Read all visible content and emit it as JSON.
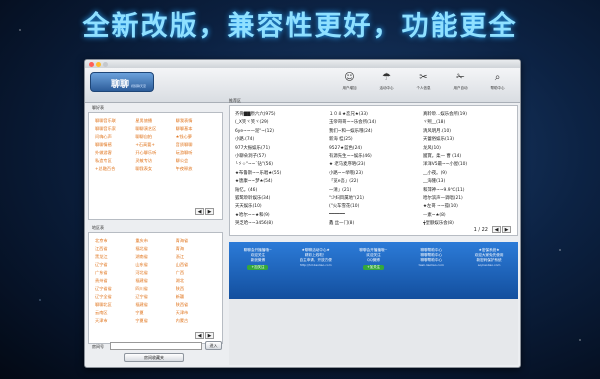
{
  "headline": "全新改版，兼容性更好，功能更全",
  "app": {
    "logo_text": "聊聊",
    "logo_sub": "视频聊天室"
  },
  "toolbar": [
    {
      "icon": "user-icon",
      "label": "用户增加"
    },
    {
      "icon": "umbrella-icon",
      "label": "活动中心"
    },
    {
      "icon": "tools-icon",
      "label": "个人信息"
    },
    {
      "icon": "scissors-icon",
      "label": "用户自动"
    },
    {
      "icon": "search-icon",
      "label": "帮助中心"
    }
  ],
  "favorites": {
    "title": "聊好表",
    "items": [
      "聊聊音乐联",
      "星男旅播",
      "聊我表情",
      "聊聊音乐家",
      "聊聊演艺区",
      "聊聊基本",
      "问嗨心声",
      "聊聊自拍",
      "★钱心夢",
      "聊聊情感",
      "+石高要+",
      "音质聊聊",
      "外做游客",
      "开心聊乐听",
      "玩游聊听",
      "私造专区",
      "灵敏专访",
      "聊公会",
      "+总融百合",
      "聊我表女",
      "午夜释放"
    ],
    "pager": [
      "◀",
      "▶"
    ]
  },
  "regions": {
    "title": "地区表",
    "items": [
      "北京市",
      "重庆市",
      "青海省",
      "江西省",
      "福北省",
      "青海",
      "黑龙江",
      "湖南省",
      "浙江",
      "辽宁省",
      "山东省",
      "山西省",
      "广东省",
      "河北省",
      "广西",
      "贵州省",
      "福建省",
      "湖北",
      "辽宁省省",
      "四川省",
      "陕西",
      "辽宁全省",
      "辽宁省",
      "新疆",
      "聊聊北区",
      "福建省",
      "陕西省",
      "云南区",
      "宁夏",
      "天津市",
      "天津市",
      "宁夏省",
      "内蒙古"
    ],
    "pager": [
      "◀",
      "▶"
    ]
  },
  "room": {
    "label": "房间号",
    "value": "",
    "enter_button": "进入",
    "bookmark_button": "房间收藏夹"
  },
  "recommend": {
    "title": "推荐区",
    "rooms": [
      "齐骨▇▇原六六(975)",
      "１０８★恋兄★(33)",
      "真聆聆...娱乐会所(19)",
      "(_X笑ヾ笑ヾ(29)",
      "玉帝哥哥~~乐会所(14)",
      "ヾ熙__(18)",
      "6ye~~一泥\"~(12)",
      "我们~和一娱乐哦(24)",
      "清风明月.(10)",
      "小路.(74)",
      "新海 桂(25)",
      "天蕾俗娱乐(13)",
      "977大振娱乐(71)",
      "9527★蓝色(24)",
      "龙风(10)",
      "小聊朵洞子(57)",
      "有源先生~~娱乐(46)",
      "國寶。柔一 曹 (14)",
      "╰ゞ☆\"~~`钻\"(56)",
      "★ 老马麦序晤(23)",
      "洋洋V5最~~小屋(10)",
      "★布鲁斯~~乐唱★(55)",
      "小路~~举哦(23)",
      "__小夜。(9)",
      "★唐康~~梦★(54)",
      "「览e吾」(22)",
      "__海隆(13)",
      "陆忆。(46)",
      "一清」(21)",
      "和萍神~~9.9℃(11)",
      "狐鹭聆聆娱乐(34)",
      "\"少妇目属地\"(21)",
      "哈尔滨声一调唱(21)",
      "天天娱乐(10)",
      "(\"火车雪花(10)",
      "★左哥 ~~孤(10)",
      "★哈尔~~★和(9)",
      "━━━━━━",
      "—素~★(8)",
      "哭乏哈~~3456(8)",
      "鑫 丝一门(8)",
      "╈皇额娱乐会(8)"
    ],
    "page": "1 / 22",
    "pager": [
      "◀",
      "▶"
    ]
  },
  "ads": [
    {
      "title": "聊聊会开播播哦~",
      "line2": "欢迎关注",
      "line3": "新浪微博",
      "button": "+加关注",
      "url": ""
    },
    {
      "title": "★聊聊活动中心★",
      "line2": "精彩上线啦！",
      "line3": "自主申请，开放方便",
      "button": "",
      "url": "http://hd.liaoliao.com"
    },
    {
      "title": "聊聊会开播播哦~",
      "line2": "欢迎关注",
      "line3": "QQ微博",
      "button": "+加关注",
      "url": ""
    },
    {
      "title": "聊聊帮助中心",
      "line2": "聊聊帮助中心",
      "line3": "聊聊帮助中心",
      "button": "",
      "url": "task.liaoliao.com"
    },
    {
      "title": "★密保系统★",
      "line2": "欢迎大家免先使用",
      "line3": "新密码保护系统",
      "button": "",
      "url": "aq.liaoliao.com"
    }
  ]
}
